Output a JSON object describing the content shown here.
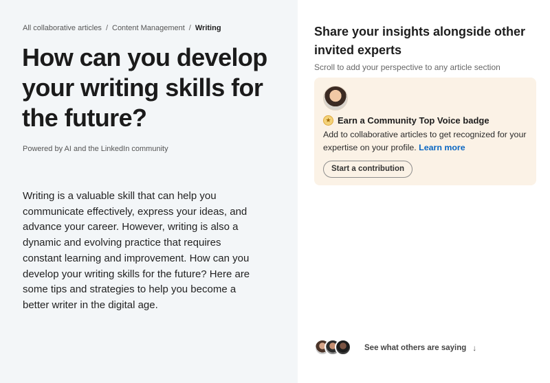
{
  "breadcrumb": {
    "items": [
      "All collaborative articles",
      "Content Management"
    ],
    "separator": "/",
    "current": "Writing"
  },
  "article": {
    "title": "How can you develop your writing skills for the future?",
    "powered_by": "Powered by AI and the LinkedIn community",
    "body": "Writing is a valuable skill that can help you communicate effectively, express your ideas, and advance your career. However, writing is also a dynamic and evolving practice that requires constant learning and improvement. How can you develop your writing skills for the future? Here are some tips and strategies to help you become a better writer in the digital age."
  },
  "sidebar": {
    "title": "Share your insights alongside other invited experts",
    "subtitle": "Scroll to add your perspective to any article section",
    "card": {
      "badge_title": "Earn a Community Top Voice badge",
      "description": "Add to collaborative articles to get recognized for your expertise on your profile.",
      "learn_more": "Learn more",
      "contribute_button": "Start a contribution"
    },
    "others_label": "See what others are saying"
  },
  "colors": {
    "left_background": "#f3f6f8",
    "card_background": "#fbf2e6",
    "link": "#0a66c2"
  },
  "icons": {
    "badge": "community-top-voice-badge-icon",
    "arrow": "arrow-down-icon"
  }
}
